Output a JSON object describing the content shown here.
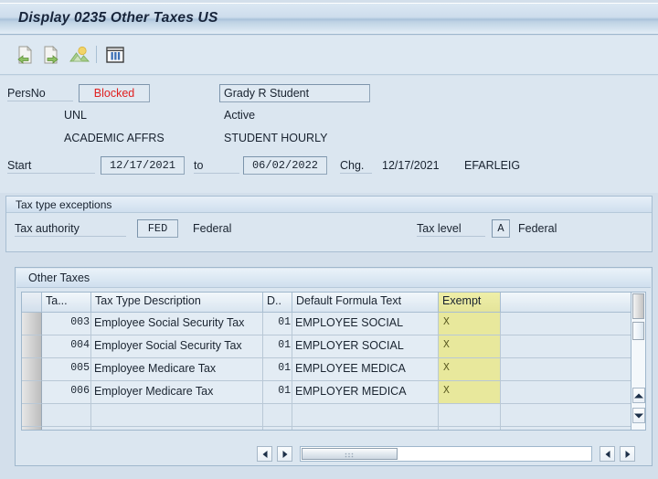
{
  "window": {
    "title": "Display 0235 Other Taxes US"
  },
  "toolbar": {
    "buttons": [
      {
        "name": "previous-record-icon",
        "label": "Previous record"
      },
      {
        "name": "next-record-icon",
        "label": "Next record"
      },
      {
        "name": "overview-icon",
        "label": "Overview"
      },
      {
        "name": "table-display-icon",
        "label": "Table display"
      }
    ]
  },
  "header": {
    "persno_label": "PersNo",
    "persno_value": "Blocked",
    "name_value": "Grady R Student",
    "org_unit": "UNL",
    "status": "Active",
    "department": "ACADEMIC AFFRS",
    "position": "STUDENT HOURLY",
    "start_label": "Start",
    "start_value": "12/17/2021",
    "to_label": "to",
    "end_value": "06/02/2022",
    "chg_label": "Chg.",
    "chg_date": "12/17/2021",
    "chg_user": "EFARLEIG"
  },
  "exceptions": {
    "group_title": "Tax type exceptions",
    "tax_authority_label": "Tax authority",
    "tax_authority_value": "FED",
    "tax_authority_text": "Federal",
    "tax_level_label": "Tax level",
    "tax_level_value": "A",
    "tax_level_text": "Federal"
  },
  "table": {
    "title": "Other Taxes",
    "columns": [
      "Ta...",
      "Tax Type Description",
      "D..",
      "Default Formula Text",
      "Exempt"
    ],
    "rows": [
      {
        "tax_type": "003",
        "description": "Employee Social Security Tax",
        "d": "01",
        "formula": "EMPLOYEE SOCIAL",
        "exempt": "X"
      },
      {
        "tax_type": "004",
        "description": "Employer Social Security Tax",
        "d": "01",
        "formula": "EMPLOYER SOCIAL",
        "exempt": "X"
      },
      {
        "tax_type": "005",
        "description": "Employee Medicare Tax",
        "d": "01",
        "formula": "EMPLOYEE MEDICA",
        "exempt": "X"
      },
      {
        "tax_type": "006",
        "description": "Employer Medicare Tax",
        "d": "01",
        "formula": "EMPLOYER MEDICA",
        "exempt": "X"
      },
      {
        "tax_type": "",
        "description": "",
        "d": "",
        "formula": "",
        "exempt": ""
      },
      {
        "tax_type": "",
        "description": "",
        "d": "",
        "formula": "",
        "exempt": ""
      }
    ]
  },
  "colors": {
    "accent": "#a9c2da",
    "exempt_highlight": "#e8e89c",
    "blocked_text": "#e02020",
    "panel_bg": "#dbe6f0"
  }
}
